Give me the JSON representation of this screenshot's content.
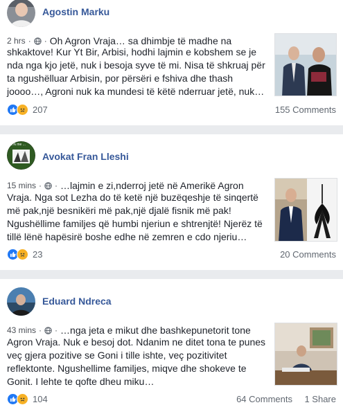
{
  "posts": [
    {
      "author": "Agostin Marku",
      "time": "2 hrs",
      "text_line1": "Oh Agron Vraja… sa dhimbje të madhe na",
      "text_rest": "shkaktove! Kur Yt Bir, Arbisi, hodhi lajmin e kobshem se je nda nga kjo jetë, nuk i besoja syve të mi. Nisa të shkruaj për ta ngushëlluar Arbisin, por përsëri e fshiva dhe thash joooo…, Agroni nuk ka mundesi të këtë nderruar jetë, nuk…",
      "reactions": "207",
      "comments": "155 Comments",
      "shares": ""
    },
    {
      "author": "Avokat Fran Lleshi",
      "time": "15 mins",
      "text_line1": "…lajmin e zi,nderroj jetë në Amerikë Agron",
      "text_rest": "Vraja. Nga sot Lezha do të ketë një buzëqeshje të sinqertë më pak,një besnikëri më pak,një djalë fisnik më pak! Ngushëllime familjes që humbi njeriun e shtrenjtë! Njerëz të tillë lënë hapësirë boshe edhe në zemren e cdo njeriu…",
      "reactions": "23",
      "comments": "20 Comments",
      "shares": ""
    },
    {
      "author": "Eduard Ndreca",
      "time": "43 mins",
      "text_line1": "…nga jeta e mikut dhe bashkepunetorit tone",
      "text_rest": "Agron Vraja. Nuk e besoj dot. Ndanim ne ditet tona te punes veç gjera pozitive se Goni i tille ishte, veç pozitivitet reflektonte. Ngushellime familjes, miqve dhe shokeve te Gonit. I lehte te qofte dheu miku…",
      "reactions": "104",
      "comments": "64 Comments",
      "shares": "1 Share"
    }
  ],
  "avatar_badge_text": "42% me ...",
  "colors": {
    "name": "#365899",
    "like": "#2078f4",
    "sad": "#f7b125",
    "bg": "#e9ebee"
  }
}
